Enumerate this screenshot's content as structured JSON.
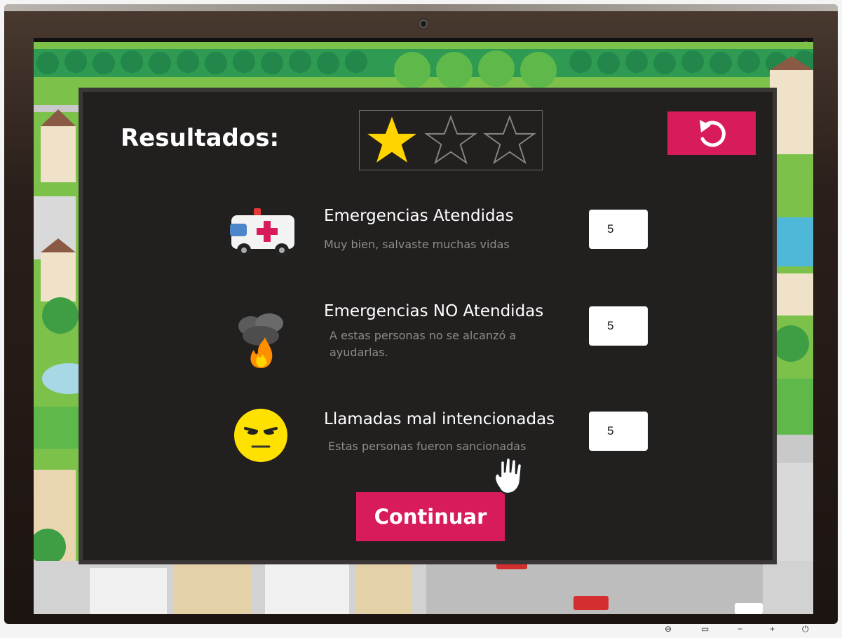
{
  "window": {
    "controls": "_ ▫ ×"
  },
  "results": {
    "title": "Resultados:",
    "stars": {
      "earned": 1,
      "total": 3
    },
    "restart_icon": "restart-icon",
    "rows": [
      {
        "title": "Emergencias Atendidas",
        "subtitle": "Muy bien, salvaste muchas vidas",
        "value": "5",
        "icon": "ambulance-icon"
      },
      {
        "title": "Emergencias NO Atendidas",
        "subtitle_line1": "A estas personas no se alcanzó a",
        "subtitle_line2": "ayudarlas.",
        "value": "5",
        "icon": "fire-icon"
      },
      {
        "title": "Llamadas mal intencionadas",
        "subtitle": "Estas personas fueron sancionadas",
        "value": "5",
        "icon": "annoyed-face-icon"
      }
    ],
    "continue_label": "Continuar"
  },
  "colors": {
    "accent": "#d81b5a",
    "dialog_bg": "#221f1f",
    "star_fill": "#ffd400",
    "text_primary": "#ffffff",
    "text_secondary": "#8f8b8b"
  }
}
